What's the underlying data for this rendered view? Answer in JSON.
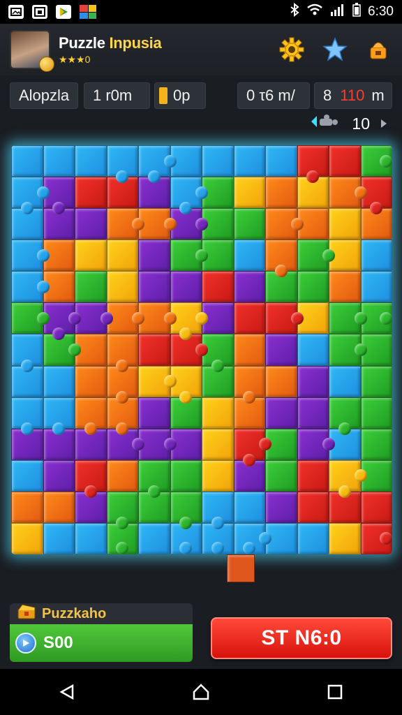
{
  "status_bar": {
    "time": "6:30",
    "icons": [
      "gallery-icon",
      "photo-icon",
      "play-store-icon",
      "color-app-icon",
      "bluetooth-icon",
      "wifi-icon",
      "signal-icon",
      "battery-icon"
    ]
  },
  "header": {
    "title_part1": "Puzzle",
    "title_part2": "Inpusia",
    "rating_text": "★★★0",
    "buttons": [
      "settings-gear-icon",
      "star-icon",
      "shop-icon"
    ]
  },
  "info_row": {
    "mode_label": "Alopzla",
    "time_label": "1 r0m",
    "pause_value": "0p",
    "score_text": "0 τ6 m/",
    "moves_prefix": "8",
    "moves_red": "110",
    "moves_suffix": "m"
  },
  "counter": {
    "value": "10"
  },
  "bottom": {
    "panel_title": "Puzzkaho",
    "panel_value": "S00",
    "start_button": "ST N6:0"
  },
  "colors": {
    "board_glow": "#5fe1ff",
    "start_button": "#e8201a",
    "panel_bar": "#3fb32e",
    "accent_gold": "#ffd54a"
  }
}
